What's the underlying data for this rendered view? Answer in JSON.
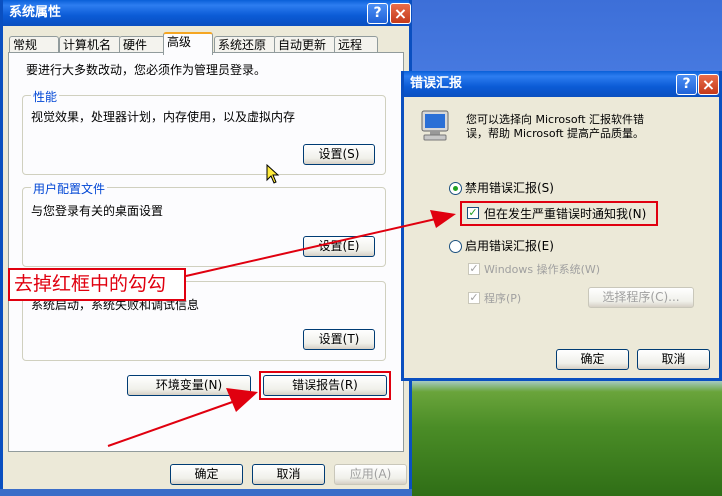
{
  "colors": {
    "accent": "#0a5fd8",
    "annotation_red": "#e0000f",
    "check_green": "#21a121"
  },
  "system_properties": {
    "title": "系统属性",
    "tabs": [
      "常规",
      "计算机名",
      "硬件",
      "高级",
      "系统还原",
      "自动更新",
      "远程"
    ],
    "active_tab": "高级",
    "admin_note": "要进行大多数改动，您必须作为管理员登录。",
    "performance": {
      "label": "性能",
      "desc": "视觉效果，处理器计划，内存使用，以及虚拟内存",
      "button": "设置(S)"
    },
    "user_profiles": {
      "label": "用户配置文件",
      "desc": "与您登录有关的桌面设置",
      "button": "设置(E)"
    },
    "startup": {
      "desc": "系统启动，系统失败和调试信息",
      "button": "设置(T)"
    },
    "env_button": "环境变量(N)",
    "error_report_button": "错误报告(R)",
    "ok": "确定",
    "cancel": "取消",
    "apply": "应用(A)"
  },
  "error_reporting": {
    "title": "错误汇报",
    "description_line1": "您可以选择向 Microsoft 汇报软件错",
    "description_line2": "误，帮助 Microsoft 提高产品质量。",
    "disable_option": "禁用错误汇报(S)",
    "disable_selected": true,
    "notify_checkbox": "但在发生严重错误时通知我(N)",
    "notify_checked": true,
    "enable_option": "启用错误汇报(E)",
    "windows_checkbox": "Windows 操作系统(W)",
    "programs_checkbox": "程序(P)",
    "choose_programs_button": "选择程序(C)...",
    "ok": "确定",
    "cancel": "取消"
  },
  "annotation": {
    "text": "去掉红框中的勾勾"
  },
  "icons": {
    "help": "help-icon",
    "close": "close-icon",
    "computer": "computer-error-icon"
  }
}
